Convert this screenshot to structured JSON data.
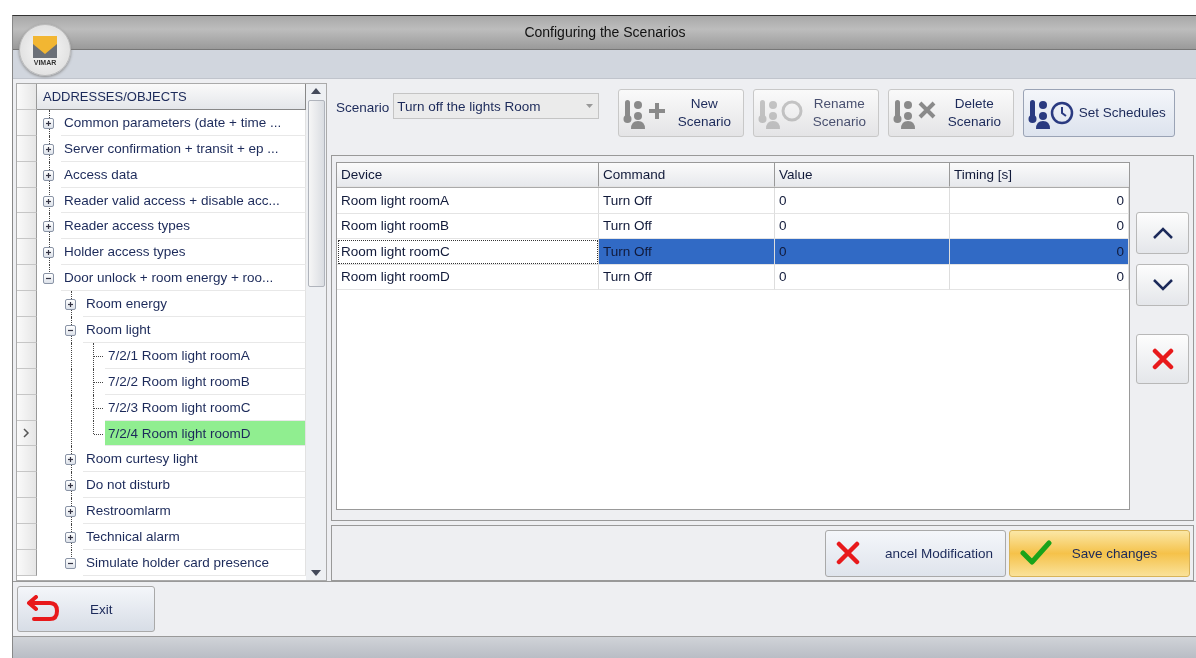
{
  "window": {
    "title": "Configuring the Scenarios",
    "logo_text": "VIMAR"
  },
  "tree": {
    "header": "ADDRESSES/OBJECTS",
    "items": [
      {
        "label": "Common parameters (date + time ...",
        "expanded": false,
        "selected": false
      },
      {
        "label": "Server confirmation + transit + ep ...",
        "expanded": false,
        "selected": false
      },
      {
        "label": "Access data",
        "expanded": false,
        "selected": false
      },
      {
        "label": "Reader valid access + disable acc...",
        "expanded": false,
        "selected": false
      },
      {
        "label": "Reader access types",
        "expanded": false,
        "selected": false
      },
      {
        "label": "Holder access types",
        "expanded": false,
        "selected": false
      },
      {
        "label": "Door unlock + room energy + roo...",
        "expanded": true,
        "selected": false,
        "children": [
          {
            "label": "Room energy",
            "expanded": false,
            "selected": false
          },
          {
            "label": "Room light",
            "expanded": true,
            "selected": false,
            "children": [
              {
                "label": "7/2/1 Room light roomA",
                "selected": false
              },
              {
                "label": "7/2/2 Room light roomB",
                "selected": false
              },
              {
                "label": "7/2/3 Room light roomC",
                "selected": false
              },
              {
                "label": "7/2/4 Room light roomD",
                "selected": true
              }
            ]
          },
          {
            "label": "Room curtesy light",
            "expanded": false,
            "selected": false
          },
          {
            "label": "Do not disturb",
            "expanded": false,
            "selected": false
          },
          {
            "label": "Restroomlarm",
            "expanded": false,
            "selected": false
          },
          {
            "label": "Technical alarm",
            "expanded": false,
            "selected": false
          },
          {
            "label": "Simulate holder card presence",
            "expanded": true,
            "selected": false
          }
        ]
      }
    ]
  },
  "scenario": {
    "label": "Scenario",
    "value": "Turn off the lights Room"
  },
  "toolbar": [
    {
      "kind": "new",
      "label": "New Scenario",
      "disabled": false,
      "highlighted": false
    },
    {
      "kind": "rename",
      "label": "Rename Scenario",
      "disabled": true,
      "highlighted": false
    },
    {
      "kind": "delete",
      "label": "Delete Scenario",
      "disabled": false,
      "highlighted": false
    },
    {
      "kind": "schedule",
      "label": "Set Schedules",
      "disabled": false,
      "highlighted": true
    }
  ],
  "table": {
    "columns": [
      "Device",
      "Command",
      "Value",
      "Timing [s]"
    ],
    "rows": [
      {
        "cells": [
          "Room light roomA",
          "Turn Off",
          "0",
          "0"
        ],
        "selected": false
      },
      {
        "cells": [
          "Room light roomB",
          "Turn Off",
          "0",
          "0"
        ],
        "selected": false
      },
      {
        "cells": [
          "Room light roomC",
          "Turn Off",
          "0",
          "0"
        ],
        "selected": true
      },
      {
        "cells": [
          "Room light roomD",
          "Turn Off",
          "0",
          "0"
        ],
        "selected": false
      }
    ]
  },
  "side_buttons": [
    {
      "kind": "up"
    },
    {
      "kind": "down"
    },
    {
      "kind": "remove"
    }
  ],
  "bottom_buttons": [
    {
      "kind": "cancel",
      "label": "ancel Modification",
      "highlighted": false
    },
    {
      "kind": "save",
      "label": "Save changes",
      "highlighted": true
    }
  ],
  "exit_button": {
    "label": "Exit"
  }
}
